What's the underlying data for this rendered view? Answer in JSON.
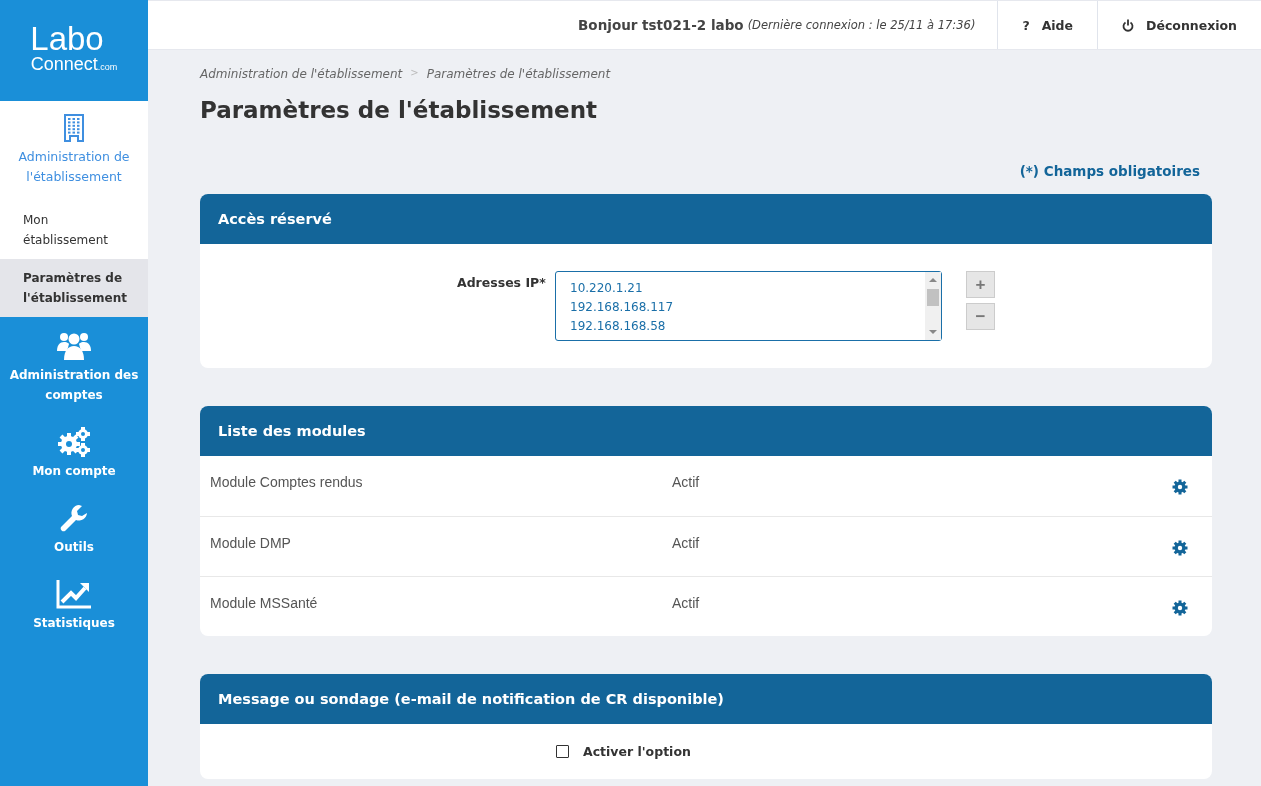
{
  "logo": {
    "line1": "Labo",
    "line2": "Connect",
    "suffix": ".com"
  },
  "sidebar": {
    "items": [
      {
        "label": "Administration de l'établissement",
        "selected": true,
        "children": [
          {
            "label": "Mon établissement",
            "selected": false
          },
          {
            "label": "Paramètres de l'établissement",
            "selected": true
          }
        ]
      },
      {
        "label": "Administration des comptes",
        "selected": false
      },
      {
        "label": "Mon compte",
        "selected": false
      },
      {
        "label": "Outils",
        "selected": false
      },
      {
        "label": "Statistiques",
        "selected": false
      }
    ]
  },
  "header": {
    "greeting": "Bonjour tst021-2 labo",
    "last_login": "(Dernière connexion : le 25/11 à 17:36)",
    "help": "Aide",
    "help_glyph": "?",
    "logout": "Déconnexion"
  },
  "breadcrumb": [
    "Administration de l'établissement",
    "Paramètres de l'établissement"
  ],
  "breadcrumb_separator": ">",
  "page_title": "Paramètres de l'établissement",
  "required_note": "(*) Champs obligatoires",
  "access_panel": {
    "title": "Accès réservé",
    "label": "Adresses IP*",
    "addresses": [
      "10.220.1.21",
      "192.168.168.117",
      "192.168.168.58"
    ],
    "add": "+",
    "remove": "−"
  },
  "modules_panel": {
    "title": "Liste des modules",
    "rows": [
      {
        "name": "Module Comptes rendus",
        "status": "Actif"
      },
      {
        "name": "Module DMP",
        "status": "Actif"
      },
      {
        "name": "Module MSSanté",
        "status": "Actif"
      }
    ]
  },
  "message_panel": {
    "title": "Message ou sondage (e-mail de notification de CR disponible)",
    "option": {
      "label": "Activer l'option",
      "checked": false
    }
  }
}
